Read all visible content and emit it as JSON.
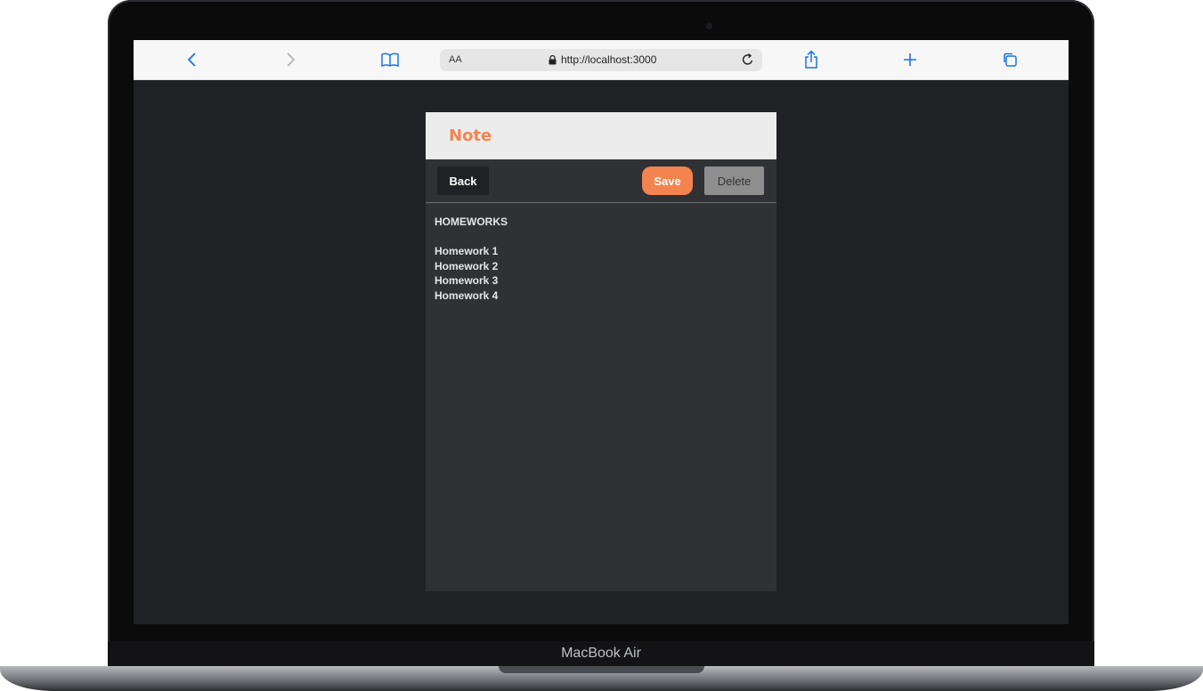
{
  "browser": {
    "text_size_label": "AA",
    "url": "http://localhost:3000"
  },
  "note": {
    "title": "Note",
    "back_label": "Back",
    "save_label": "Save",
    "delete_label": "Delete",
    "heading": "HOMEWORKS",
    "lines": [
      "Homework 1",
      "Homework 2",
      "Homework 3",
      "Homework 4"
    ]
  },
  "device": {
    "brand": "MacBook Air"
  },
  "colors": {
    "accent": "#f4844f",
    "browser_blue": "#1a73e8",
    "page_background": "#202124",
    "card_background": "#2f3134"
  },
  "icons": {
    "back": "chevron-left-icon",
    "forward": "chevron-right-icon",
    "bookmarks": "book-icon",
    "lock": "lock-icon",
    "reload": "reload-icon",
    "share": "share-icon",
    "new_tab": "plus-icon",
    "tabs": "tabs-icon"
  }
}
